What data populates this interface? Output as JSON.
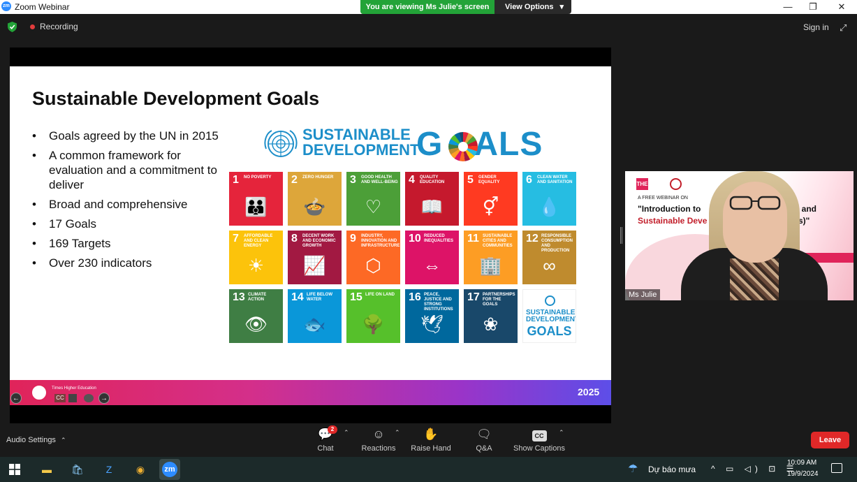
{
  "window": {
    "title": "Zoom Webinar",
    "app_icon_text": "zm",
    "minimize": "—",
    "restore": "❐",
    "close": "✕"
  },
  "share_banner": {
    "text": "You are viewing Ms Julie's screen",
    "view_options": "View Options",
    "view_options_caret": "▾"
  },
  "status_bar": {
    "recording": "Recording",
    "sign_in": "Sign in",
    "expand_icon": "⤢"
  },
  "slide": {
    "title": "Sustainable Development Goals",
    "bullets": [
      "Goals agreed by the UN in 2015",
      "A common framework for evaluation and a commitment to deliver",
      "Broad and comprehensive",
      "17 Goals",
      "169 Targets",
      "Over 230 indicators"
    ],
    "logo": {
      "line1": "SUSTAINABLE",
      "line2": "DEVELOPMENT",
      "goals_g": "G",
      "goals_rest": "ALS"
    },
    "goals": [
      {
        "num": "1",
        "label": "No poverty",
        "icon": "👪",
        "color": "#e5243b"
      },
      {
        "num": "2",
        "label": "Zero hunger",
        "icon": "🍲",
        "color": "#dda63a"
      },
      {
        "num": "3",
        "label": "Good health and well-being",
        "icon": "♡",
        "color": "#4c9f38"
      },
      {
        "num": "4",
        "label": "Quality education",
        "icon": "📖",
        "color": "#c5192d"
      },
      {
        "num": "5",
        "label": "Gender equality",
        "icon": "⚥",
        "color": "#ff3a21"
      },
      {
        "num": "6",
        "label": "Clean water and sanitation",
        "icon": "💧",
        "color": "#26bde2"
      },
      {
        "num": "7",
        "label": "Affordable and clean energy",
        "icon": "☀",
        "color": "#fcc30b"
      },
      {
        "num": "8",
        "label": "Decent work and economic growth",
        "icon": "📈",
        "color": "#a21942"
      },
      {
        "num": "9",
        "label": "Industry, innovation and infrastructure",
        "icon": "⬡",
        "color": "#fd6925"
      },
      {
        "num": "10",
        "label": "Reduced inequalities",
        "icon": "⇔",
        "color": "#dd1367"
      },
      {
        "num": "11",
        "label": "Sustainable cities and communities",
        "icon": "🏢",
        "color": "#fd9d24"
      },
      {
        "num": "12",
        "label": "Responsible consumption and production",
        "icon": "∞",
        "color": "#bf8b2e"
      },
      {
        "num": "13",
        "label": "Climate action",
        "icon": "👁",
        "color": "#3f7e44"
      },
      {
        "num": "14",
        "label": "Life below water",
        "icon": "🐟",
        "color": "#0a97d9"
      },
      {
        "num": "15",
        "label": "Life on land",
        "icon": "🌳",
        "color": "#56c02b"
      },
      {
        "num": "16",
        "label": "Peace, justice and strong institutions",
        "icon": "🕊",
        "color": "#00689d"
      },
      {
        "num": "17",
        "label": "Partnerships for the goals",
        "icon": "❀",
        "color": "#19486a"
      }
    ],
    "logo_tile": {
      "text": "SUSTAINABLE DEVELOPMENT",
      "goals": "GOALS"
    },
    "footer_year": "2025",
    "footer_org": "Times Higher Education",
    "nav_prev": "←",
    "nav_next": "→",
    "cc": "CC"
  },
  "video": {
    "name": "Ms Julie",
    "the_badge": "THE",
    "line1": "A FREE WEBINAR ON",
    "line2a": "\"Introduction to",
    "line2b": "kings and",
    "line3a": "Sustainable Deve",
    "line3b": "SDGs)\""
  },
  "toolbar": {
    "audio_settings": "Audio Settings",
    "chat": "Chat",
    "chat_badge": "2",
    "reactions": "Reactions",
    "raise_hand": "Raise Hand",
    "qa": "Q&A",
    "show_captions": "Show Captions",
    "captions_icon": "CC",
    "leave": "Leave",
    "caret_up": "⌃"
  },
  "taskbar": {
    "weather": "Dự báo mưa",
    "time": "10:09 AM",
    "date": "19/9/2024",
    "zoom_label": "zm",
    "tray": "^ ▭ ◁) ⊡ ☰"
  }
}
